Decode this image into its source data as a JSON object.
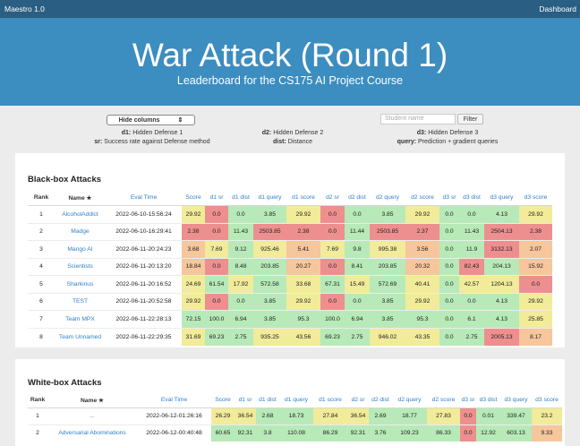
{
  "app": {
    "title": "Maestro 1.0",
    "nav_link": "Dashboard"
  },
  "hero": {
    "title": "War Attack (Round 1)",
    "subtitle": "Leaderboard for the CS175 AI Project Course"
  },
  "controls": {
    "columns_select": "Hide columns",
    "columns_select_arrow": "⇕",
    "search_placeholder": "Student name",
    "filter_label": "Filter"
  },
  "legend": [
    {
      "key": "d1:",
      "text": "Hidden Defense 1"
    },
    {
      "key": "d2:",
      "text": "Hidden Defense 2"
    },
    {
      "key": "d3:",
      "text": "Hidden Defense 3"
    },
    {
      "key": "sr:",
      "text": "Success rate against Defense method"
    },
    {
      "key": "dist:",
      "text": "Distance"
    },
    {
      "key": "query:",
      "text": "Prediction + gradient queries"
    }
  ],
  "colors": {
    "green": "#b7eab8",
    "yellow": "#f1eb9a",
    "orange": "#f6c69c",
    "red": "#ee8f8f"
  },
  "columns": [
    "Rank",
    "Name ★",
    "Eval Time",
    "Score",
    "d1 sr",
    "d1 dist",
    "d1 query",
    "d1 score",
    "d2 sr",
    "d2 dist",
    "d2 query",
    "d2 score",
    "d3 sr",
    "d3 dist",
    "d3 query",
    "d3 score"
  ],
  "blackbox": {
    "title": "Black-box Attacks",
    "rows": [
      {
        "rank": "1",
        "name": "AlcoholAddict",
        "time": "2022-06-10-15:56:24",
        "vals": [
          "29.92",
          "0.0",
          "0.0",
          "3.85",
          "29.92",
          "0.0",
          "0.0",
          "3.85",
          "29.92",
          "0.0",
          "0.0",
          "4.13",
          "29.92"
        ],
        "cls": [
          "y",
          "r",
          "g",
          "g",
          "y",
          "r",
          "g",
          "g",
          "y",
          "g",
          "g",
          "g",
          "y"
        ]
      },
      {
        "rank": "2",
        "name": "Madge",
        "time": "2022-06-10-16:29:41",
        "vals": [
          "2.38",
          "0.0",
          "11.43",
          "2503.85",
          "2.38",
          "0.0",
          "11.44",
          "2503.85",
          "2.37",
          "0.0",
          "11.43",
          "2504.13",
          "2.38"
        ],
        "cls": [
          "r",
          "r",
          "g",
          "r",
          "r",
          "r",
          "g",
          "r",
          "r",
          "g",
          "g",
          "r",
          "r"
        ]
      },
      {
        "rank": "3",
        "name": "Mango AI",
        "time": "2022-06-11-20:24:23",
        "vals": [
          "3.68",
          "7.69",
          "9.12",
          "925.46",
          "5.41",
          "7.69",
          "9.8",
          "995.38",
          "3.56",
          "0.0",
          "11.9",
          "3132.13",
          "2.07"
        ],
        "cls": [
          "o",
          "y",
          "g",
          "y",
          "o",
          "y",
          "g",
          "y",
          "o",
          "g",
          "g",
          "r",
          "o"
        ]
      },
      {
        "rank": "4",
        "name": "Scientists",
        "time": "2022-06-11-20:13:20",
        "vals": [
          "18.84",
          "0.0",
          "8.48",
          "203.85",
          "20.27",
          "0.0",
          "8.41",
          "203.85",
          "20.32",
          "0.0",
          "82.43",
          "204.13",
          "15.92"
        ],
        "cls": [
          "o",
          "r",
          "g",
          "g",
          "o",
          "r",
          "g",
          "g",
          "o",
          "g",
          "r",
          "g",
          "o"
        ]
      },
      {
        "rank": "5",
        "name": "Sharkinus",
        "time": "2022-06-11-20:16:52",
        "vals": [
          "24.69",
          "61.54",
          "17.92",
          "572.58",
          "33.68",
          "67.31",
          "15.49",
          "572.69",
          "40.41",
          "0.0",
          "42.57",
          "1204.13",
          "0.0"
        ],
        "cls": [
          "y",
          "g",
          "y",
          "g",
          "y",
          "g",
          "y",
          "g",
          "y",
          "g",
          "y",
          "y",
          "r"
        ]
      },
      {
        "rank": "6",
        "name": "TEST",
        "time": "2022-06-11-20:52:58",
        "vals": [
          "29.92",
          "0.0",
          "0.0",
          "3.85",
          "29.92",
          "0.0",
          "0.0",
          "3.85",
          "29.92",
          "0.0",
          "0.0",
          "4.13",
          "29.92"
        ],
        "cls": [
          "y",
          "r",
          "g",
          "g",
          "y",
          "r",
          "g",
          "g",
          "y",
          "g",
          "g",
          "g",
          "y"
        ]
      },
      {
        "rank": "7",
        "name": "Team MPX",
        "time": "2022-06-11-22:28:13",
        "vals": [
          "72.15",
          "100.0",
          "6.94",
          "3.85",
          "95.3",
          "100.0",
          "6.94",
          "3.85",
          "95.3",
          "0.0",
          "6.1",
          "4.13",
          "25.85"
        ],
        "cls": [
          "g",
          "g",
          "g",
          "g",
          "g",
          "g",
          "g",
          "g",
          "g",
          "g",
          "g",
          "g",
          "y"
        ]
      },
      {
        "rank": "8",
        "name": "Team Unnamed",
        "time": "2022-06-11-22:29:35",
        "vals": [
          "31.69",
          "69.23",
          "2.75",
          "935.25",
          "43.56",
          "69.23",
          "2.75",
          "946.02",
          "43.35",
          "0.0",
          "2.75",
          "2005.13",
          "8.17"
        ],
        "cls": [
          "y",
          "g",
          "g",
          "y",
          "y",
          "g",
          "g",
          "y",
          "y",
          "g",
          "g",
          "r",
          "o"
        ]
      }
    ]
  },
  "whitebox": {
    "title": "White-box Attacks",
    "rows": [
      {
        "rank": "1",
        "name": "...",
        "time": "2022-06-12-01:26:16",
        "vals": [
          "26.29",
          "36.54",
          "2.68",
          "18.73",
          "27.84",
          "36.54",
          "2.69",
          "18.77",
          "27.83",
          "0.0",
          "0.01",
          "339.47",
          "23.2"
        ],
        "cls": [
          "y",
          "y",
          "g",
          "g",
          "y",
          "y",
          "g",
          "g",
          "y",
          "r",
          "g",
          "g",
          "y"
        ]
      },
      {
        "rank": "2",
        "name": "Adversarial Abominations",
        "time": "2022-06-12-00:40:48",
        "vals": [
          "60.65",
          "92.31",
          "3.8",
          "110.08",
          "86.29",
          "92.31",
          "3.76",
          "109.23",
          "86.33",
          "0.0",
          "12.92",
          "603.13",
          "9.33"
        ],
        "cls": [
          "g",
          "g",
          "g",
          "g",
          "g",
          "g",
          "g",
          "g",
          "g",
          "r",
          "g",
          "g",
          "o"
        ]
      }
    ]
  }
}
